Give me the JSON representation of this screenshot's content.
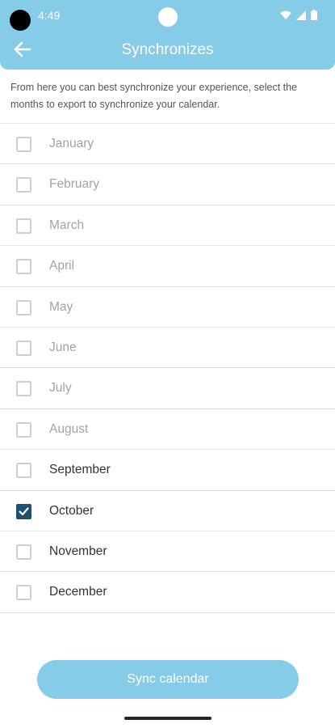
{
  "status_bar": {
    "time": "4:49",
    "icons": [
      "wifi-icon",
      "signal-icon",
      "battery-icon"
    ]
  },
  "header": {
    "title": "Synchronizes",
    "back_icon": "arrow-left-icon",
    "color": "#86cbe8"
  },
  "description": "From here you can best synchronize your experience, select the months to export to synchronize your calendar.",
  "months": [
    {
      "label": "January",
      "checked": false,
      "enabled": false
    },
    {
      "label": "February",
      "checked": false,
      "enabled": false
    },
    {
      "label": "March",
      "checked": false,
      "enabled": false
    },
    {
      "label": "April",
      "checked": false,
      "enabled": false
    },
    {
      "label": "May",
      "checked": false,
      "enabled": false
    },
    {
      "label": "June",
      "checked": false,
      "enabled": false
    },
    {
      "label": "July",
      "checked": false,
      "enabled": false
    },
    {
      "label": "August",
      "checked": false,
      "enabled": false
    },
    {
      "label": "September",
      "checked": false,
      "enabled": true
    },
    {
      "label": "October",
      "checked": true,
      "enabled": true
    },
    {
      "label": "November",
      "checked": false,
      "enabled": true
    },
    {
      "label": "December",
      "checked": false,
      "enabled": true
    }
  ],
  "sync_button": {
    "label": "Sync calendar",
    "color": "#86cbe8"
  },
  "checked_color": "#1f4f73"
}
